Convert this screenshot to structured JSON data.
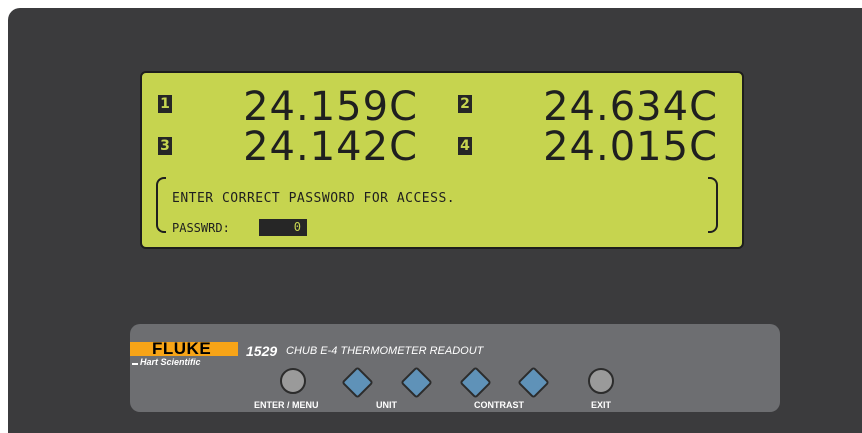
{
  "display": {
    "channels": [
      {
        "number": "1",
        "reading": "24.159C"
      },
      {
        "number": "2",
        "reading": "24.634C"
      },
      {
        "number": "3",
        "reading": "24.142C"
      },
      {
        "number": "4",
        "reading": "24.015C"
      }
    ],
    "message": "ENTER CORRECT PASSWORD FOR ACCESS.",
    "password_label": "PASSWRD:",
    "password_value": "0"
  },
  "panel": {
    "brand": "FLUKE",
    "sub_brand": "Hart Scientific",
    "model": "1529",
    "description": "CHUB E-4 THERMOMETER READOUT",
    "buttons": {
      "enter_menu": "ENTER / MENU",
      "unit": "UNIT",
      "contrast": "CONTRAST",
      "exit": "EXIT"
    }
  },
  "colors": {
    "lcd_background": "#c6d44f",
    "housing": "#3b3b3d",
    "panel": "#6d6e71",
    "brand_orange": "#f7a417",
    "diamond_button": "#5f92b8"
  }
}
